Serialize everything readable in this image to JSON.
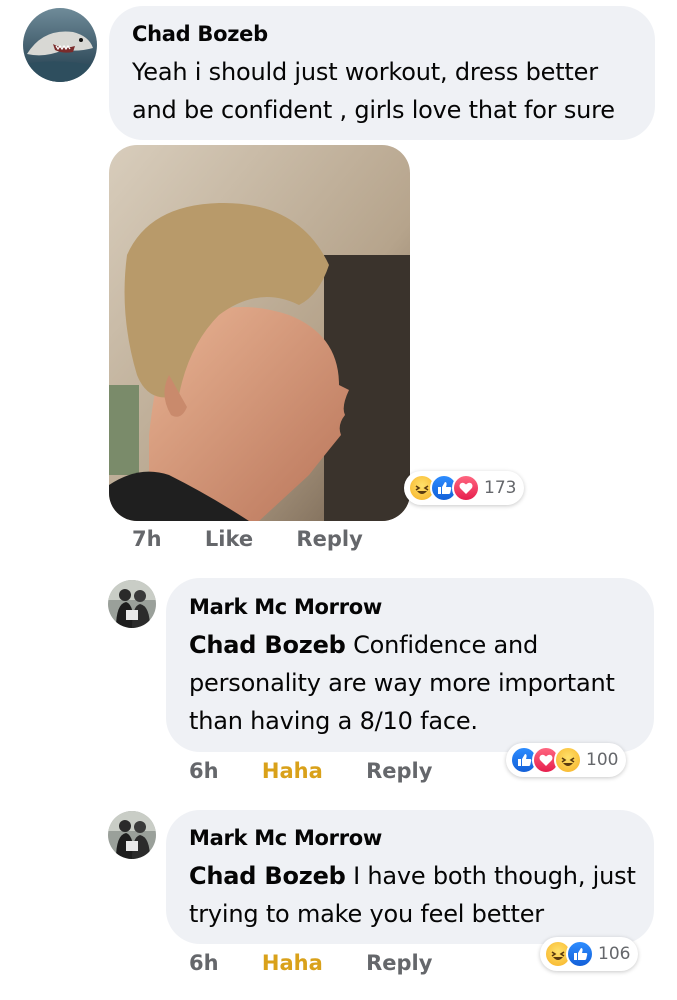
{
  "comments": [
    {
      "author": "Chad Bozeb",
      "text_lines": [
        "Yeah i should just workout, dress better",
        "and be confident , girls love that for sure"
      ],
      "time": "7h",
      "like_label": "Like",
      "reply_label": "Reply",
      "reaction_icons": [
        "haha-icon",
        "like-icon",
        "love-icon"
      ],
      "reaction_count": "173"
    },
    {
      "author": "Mark Mc Morrow",
      "mention": "Chad Bozeb",
      "text_lines": [
        " Confidence and",
        "personality are way more important",
        "than having a 8/10 face."
      ],
      "time": "6h",
      "like_label": "Haha",
      "reply_label": "Reply",
      "reaction_icons": [
        "like-icon",
        "love-icon",
        "haha-icon"
      ],
      "reaction_count": "100"
    },
    {
      "author": "Mark Mc Morrow",
      "mention": "Chad Bozeb",
      "text_lines": [
        " I have both though, just",
        "trying to make you feel better"
      ],
      "time": "6h",
      "like_label": "Haha",
      "reply_label": "Reply",
      "reaction_icons": [
        "haha-icon",
        "like-icon"
      ],
      "reaction_count": "106"
    }
  ],
  "colors": {
    "bubble": "#eff1f5",
    "meta_text": "#65676b",
    "haha_active": "#d9a11a",
    "like": "#1877f2",
    "love": "#f33e58"
  }
}
